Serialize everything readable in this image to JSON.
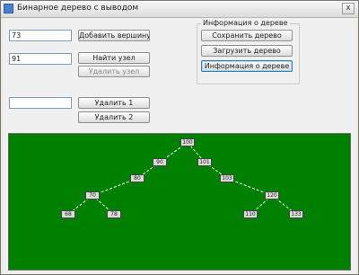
{
  "window": {
    "title": "Бинарное дерево с выводом",
    "close_glyph": "x"
  },
  "controls": {
    "add_value": "73",
    "add_button": "Добавить вершину",
    "find_value": "91",
    "find_button": "Найти узел",
    "delete_node_button": "Удалить узел",
    "remove_value": "",
    "remove1_button": "Удалить 1",
    "remove2_button": "Удалить 2"
  },
  "info_group": {
    "title": "Информация о дереве",
    "save_button": "Сохранить дерево",
    "load_button": "Загрузить дерево",
    "info_button": "Информация о дереве"
  },
  "tree": {
    "edge_color": "#ffffff",
    "node_fill": "#dcdcdc",
    "background": "#008000",
    "nodes": [
      {
        "id": "root",
        "label": "100"
      },
      {
        "id": "n90",
        "label": "90"
      },
      {
        "id": "n101",
        "label": "101"
      },
      {
        "id": "n80",
        "label": "80"
      },
      {
        "id": "n103",
        "label": "103"
      },
      {
        "id": "n70",
        "label": "70"
      },
      {
        "id": "n120",
        "label": "120"
      },
      {
        "id": "n68",
        "label": "68"
      },
      {
        "id": "n78",
        "label": "78"
      },
      {
        "id": "n110",
        "label": "110"
      },
      {
        "id": "n133",
        "label": "133"
      }
    ],
    "edges": [
      [
        "root",
        "n90"
      ],
      [
        "root",
        "n101"
      ],
      [
        "n90",
        "n80"
      ],
      [
        "n101",
        "n103"
      ],
      [
        "n80",
        "n70"
      ],
      [
        "n103",
        "n120"
      ],
      [
        "n70",
        "n68"
      ],
      [
        "n70",
        "n78"
      ],
      [
        "n120",
        "n110"
      ],
      [
        "n120",
        "n133"
      ]
    ]
  }
}
